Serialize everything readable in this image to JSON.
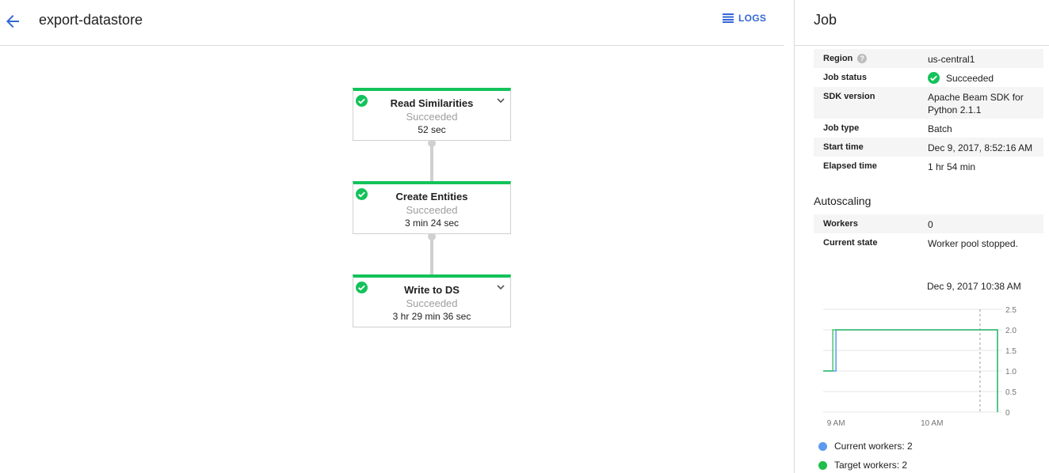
{
  "header": {
    "title": "export-datastore",
    "logs_label": "LOGS"
  },
  "pipeline": {
    "steps": [
      {
        "name": "Read Similarities",
        "status": "Succeeded",
        "duration": "52 sec"
      },
      {
        "name": "Create Entities",
        "status": "Succeeded",
        "duration": "3 min 24 sec"
      },
      {
        "name": "Write to DS",
        "status": "Succeeded",
        "duration": "3 hr 29 min 36 sec"
      }
    ]
  },
  "job": {
    "title": "Job",
    "rows": [
      {
        "label": "Region",
        "value": "us-central1"
      },
      {
        "label": "Job status",
        "value": "Succeeded"
      },
      {
        "label": "SDK version",
        "value": "Apache Beam SDK for Python 2.1.1"
      },
      {
        "label": "Job type",
        "value": "Batch"
      },
      {
        "label": "Start time",
        "value": "Dec 9, 2017, 8:52:16 AM"
      },
      {
        "label": "Elapsed time",
        "value": "1 hr 54 min"
      }
    ]
  },
  "autoscaling": {
    "title": "Autoscaling",
    "rows": [
      {
        "label": "Workers",
        "value": "0"
      },
      {
        "label": "Current state",
        "value": "Worker pool stopped."
      }
    ],
    "timestamp": "Dec 9, 2017 10:38 AM"
  },
  "colors": {
    "success": "#13c25a",
    "accent": "#3367d6",
    "current": "#5b9bf0",
    "target": "#1fbd49"
  },
  "chart_data": {
    "type": "line",
    "x_ticks": [
      "9 AM",
      "10 AM"
    ],
    "y_ticks": [
      "2.5",
      "2.0",
      "1.5",
      "1.0",
      "0.5",
      "0"
    ],
    "ylim": [
      0,
      2.5
    ],
    "x": [
      "8:52",
      "8:58",
      "9:00",
      "10:38",
      "10:40",
      "10:41"
    ],
    "series": [
      {
        "name": "Current workers: 2",
        "color": "#5b9bf0",
        "values": [
          1,
          1,
          2,
          2,
          2,
          0
        ]
      },
      {
        "name": "Target workers: 2",
        "color": "#1fbd49",
        "values": [
          1,
          2,
          2,
          2,
          2,
          0
        ]
      }
    ],
    "legend": [
      "Current workers: 2",
      "Target workers: 2"
    ]
  }
}
